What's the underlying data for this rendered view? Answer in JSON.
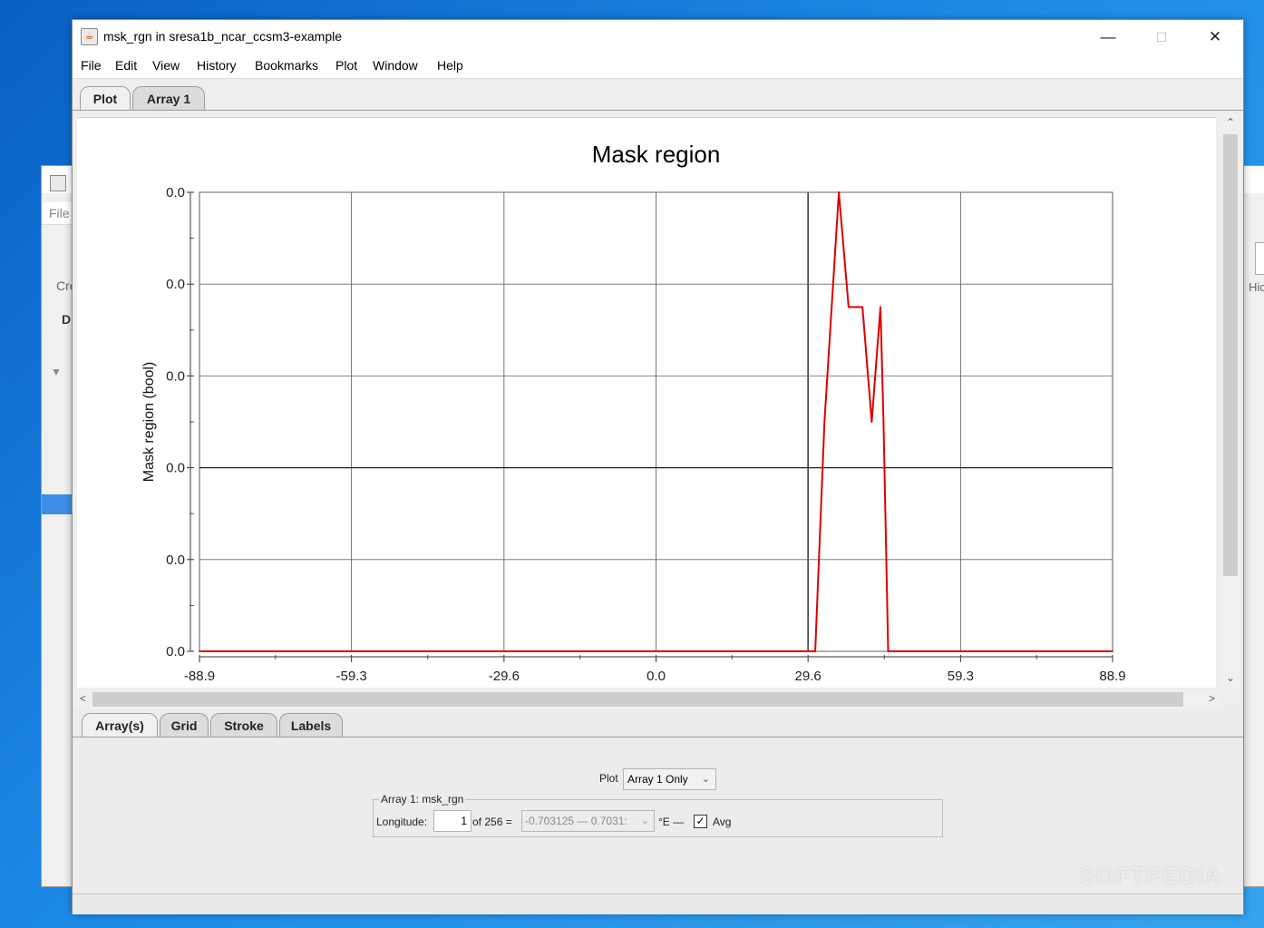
{
  "window": {
    "title": "msk_rgn in sresa1b_ncar_ccsm3-example",
    "minimize": "—",
    "maximize": "☐",
    "close": "✕"
  },
  "menu": [
    "File",
    "Edit",
    "View",
    "History",
    "Bookmarks",
    "Plot",
    "Window",
    "Help"
  ],
  "top_tabs": [
    "Plot",
    "Array 1"
  ],
  "bottom_tabs": [
    "Array(s)",
    "Grid",
    "Stroke",
    "Labels"
  ],
  "bg_window": {
    "menu_file": "File",
    "toolbar_left": "Cre",
    "tab_left": "D",
    "toolbar_right": "Hic"
  },
  "chart_data": {
    "type": "line",
    "title": "Mask region",
    "xlabel": "",
    "ylabel": "Mask region (bool)",
    "x_ticks": [
      "-88.9",
      "-59.3",
      "-29.6",
      "0.0",
      "29.6",
      "59.3",
      "88.9"
    ],
    "x_tick_values": [
      -88.9,
      -59.3,
      -29.6,
      0.0,
      29.6,
      59.3,
      88.9
    ],
    "y_ticks": [
      "0.0",
      "0.0",
      "0.0",
      "0.0",
      "0.0",
      "0.0"
    ],
    "y_tick_values": [
      0,
      0.2,
      0.4,
      0.6,
      0.8,
      1.0
    ],
    "xlim": [
      -88.9,
      88.9
    ],
    "ylim": [
      0,
      1
    ],
    "grid": true,
    "series": [
      {
        "color": "#dd0000",
        "x": [
          -88.9,
          31.0,
          32.8,
          35.6,
          37.5,
          38.6,
          40.2,
          42.0,
          43.7,
          44.3,
          45.2,
          88.9
        ],
        "y": [
          0.0,
          0.0,
          0.5,
          1.0,
          0.75,
          0.75,
          0.75,
          0.5,
          0.75,
          0.5,
          0.0,
          0.0
        ]
      }
    ]
  },
  "controls": {
    "plot_label": "Plot",
    "plot_select": "Array 1 Only",
    "group_title": "Array 1: msk_rgn",
    "longitude_label": "Longitude:",
    "index_value": "1",
    "of_total": "of 256 =",
    "range_value": "-0.703125 — 0.7031:",
    "unit_label": "°E —",
    "avg_label": "Avg",
    "avg_checked": true
  },
  "watermark": "SOFTPEDIA"
}
